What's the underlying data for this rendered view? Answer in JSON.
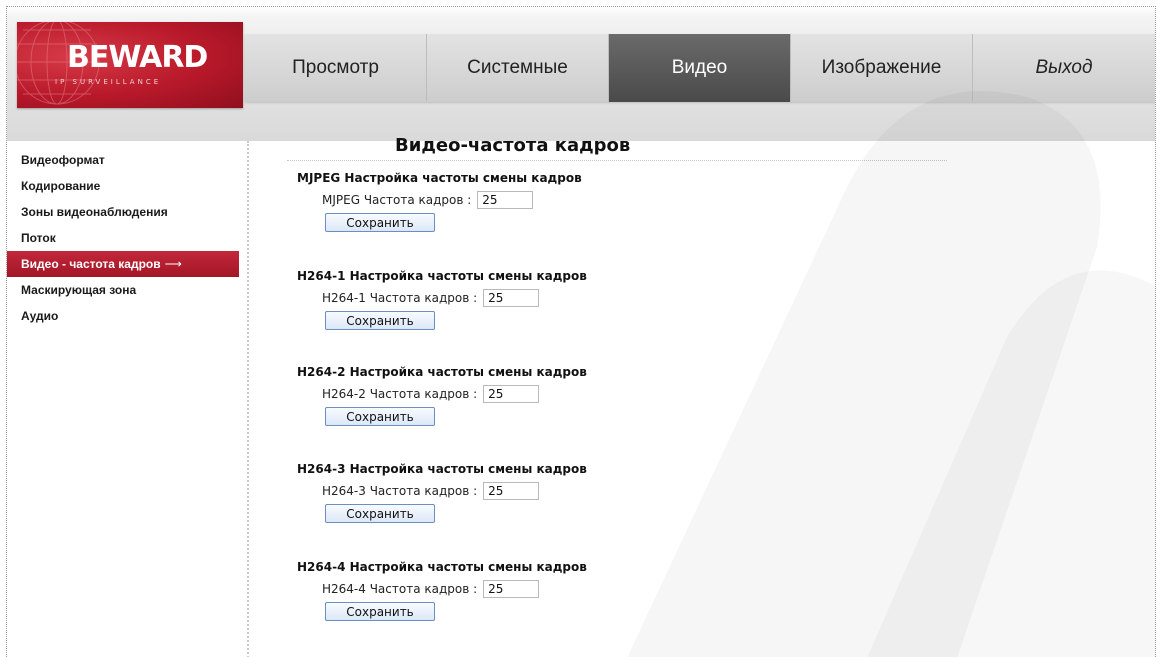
{
  "brand": {
    "name": "BEWARD",
    "tagline": "IP SURVEILLANCE"
  },
  "nav": {
    "tabs": [
      {
        "label": "Просмотр"
      },
      {
        "label": "Системные"
      },
      {
        "label": "Видео"
      },
      {
        "label": "Изображение"
      },
      {
        "label": "Выход"
      }
    ],
    "active": "Видео"
  },
  "sidebar": {
    "items": [
      {
        "label": "Видеоформат"
      },
      {
        "label": "Кодирование"
      },
      {
        "label": "Зоны видеонаблюдения"
      },
      {
        "label": "Поток"
      },
      {
        "label": "Видео - частота кадров"
      },
      {
        "label": "Маскирующая зона"
      },
      {
        "label": "Аудио"
      }
    ],
    "active_arrow": "⟶"
  },
  "page": {
    "title": "Видео-частота кадров"
  },
  "sections": [
    {
      "title": "MJPEG Настройка частоты смены кадров",
      "label": "MJPEG Частота кадров :",
      "value": "25",
      "button": "Сохранить"
    },
    {
      "title": "H264-1 Настройка частоты смены кадров",
      "label": "H264-1 Частота кадров :",
      "value": "25",
      "button": "Сохранить"
    },
    {
      "title": "H264-2 Настройка частоты смены кадров",
      "label": "H264-2 Частота кадров :",
      "value": "25",
      "button": "Сохранить"
    },
    {
      "title": "H264-3 Настройка частоты смены кадров",
      "label": "H264-3 Частота кадров :",
      "value": "25",
      "button": "Сохранить"
    },
    {
      "title": "H264-4 Настройка частоты смены кадров",
      "label": "H264-4 Частота кадров :",
      "value": "25",
      "button": "Сохранить"
    }
  ],
  "colors": {
    "accent": "#b51d2c",
    "nav_active": "#555555"
  }
}
